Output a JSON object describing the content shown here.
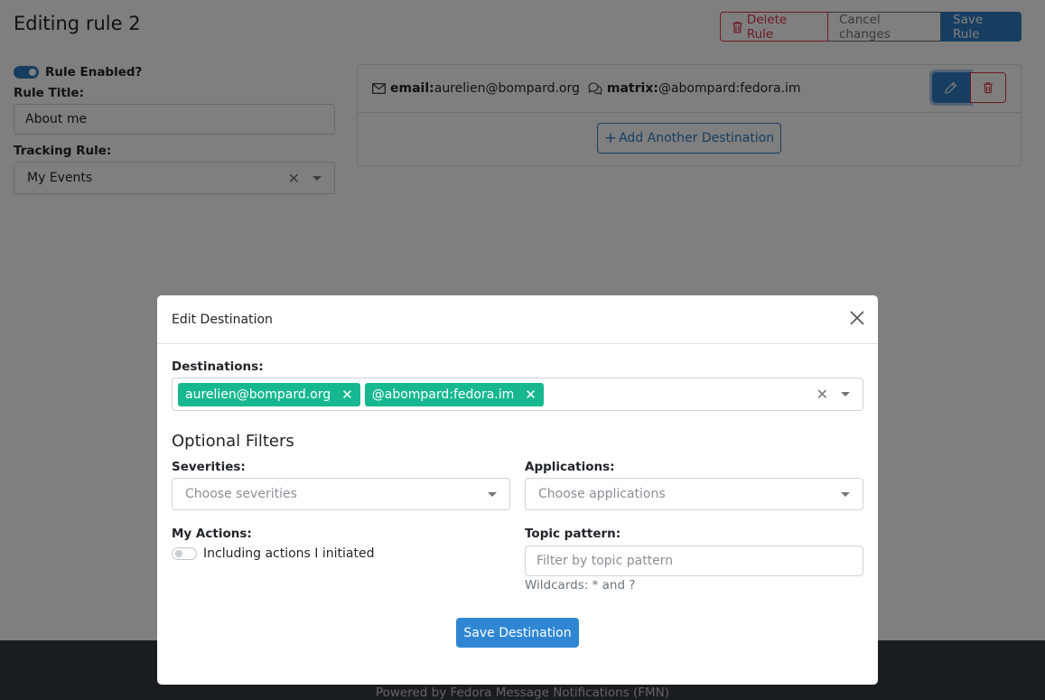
{
  "page": {
    "title": "Editing rule 2",
    "buttons": {
      "delete_label": "Delete Rule",
      "cancel_label": "Cancel changes",
      "save_label": "Save Rule"
    }
  },
  "rule": {
    "enabled_label": "Rule Enabled?",
    "enabled": true,
    "title_label": "Rule Title:",
    "title_value": "About me",
    "tracking_label": "Tracking Rule:",
    "tracking_value": "My Events"
  },
  "destinations_card": {
    "items": [
      {
        "icon": "envelope-icon",
        "type": "email:",
        "value": "aurelien@bompard.org"
      },
      {
        "icon": "chat-icon",
        "type": "matrix:",
        "value": "@abompard:fedora.im"
      }
    ],
    "add_label": "Add Another Destination"
  },
  "footer": {
    "text": "Powered by Fedora Message Notifications (FMN)"
  },
  "modal": {
    "title": "Edit Destination",
    "destinations_label": "Destinations:",
    "destination_tags": [
      "aurelien@bompard.org",
      "@abompard:fedora.im"
    ],
    "optional_filters_title": "Optional Filters",
    "severities_label": "Severities:",
    "severities_placeholder": "Choose severities",
    "applications_label": "Applications:",
    "applications_placeholder": "Choose applications",
    "my_actions_label": "My Actions:",
    "my_actions_toggle_label": "Including actions I initiated",
    "my_actions_enabled": false,
    "topic_label": "Topic pattern:",
    "topic_placeholder": "Filter by topic pattern",
    "topic_hint": "Wildcards: * and ?",
    "save_label": "Save Destination"
  },
  "colors": {
    "primary": "#2f7cc2",
    "danger": "#dc3545",
    "tag": "#17b890",
    "footer": "#343a40"
  }
}
